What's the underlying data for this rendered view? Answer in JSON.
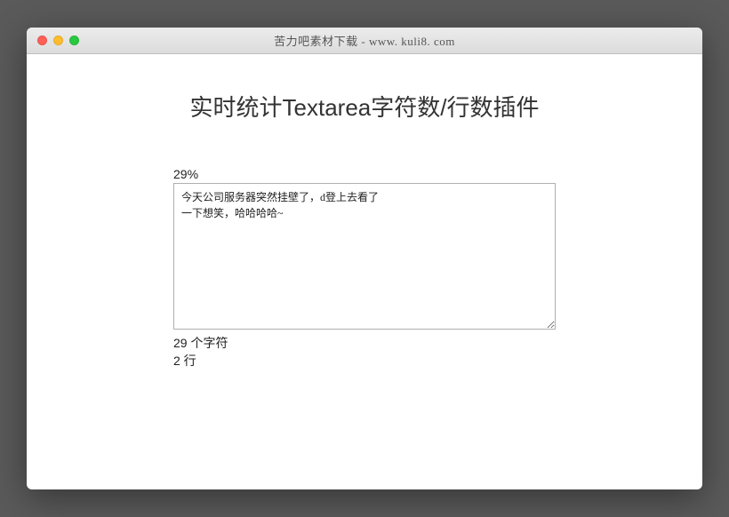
{
  "window": {
    "title": "苦力吧素材下载 - www. kuli8. com"
  },
  "page": {
    "heading": "实时统计Textarea字符数/行数插件"
  },
  "counter": {
    "percent_label": "29%",
    "textarea_value": "今天公司服务器突然挂壁了，d登上去看了\n一下想笑，哈哈哈哈~",
    "char_count_label": "29 个字符",
    "line_count_label": "2 行"
  }
}
